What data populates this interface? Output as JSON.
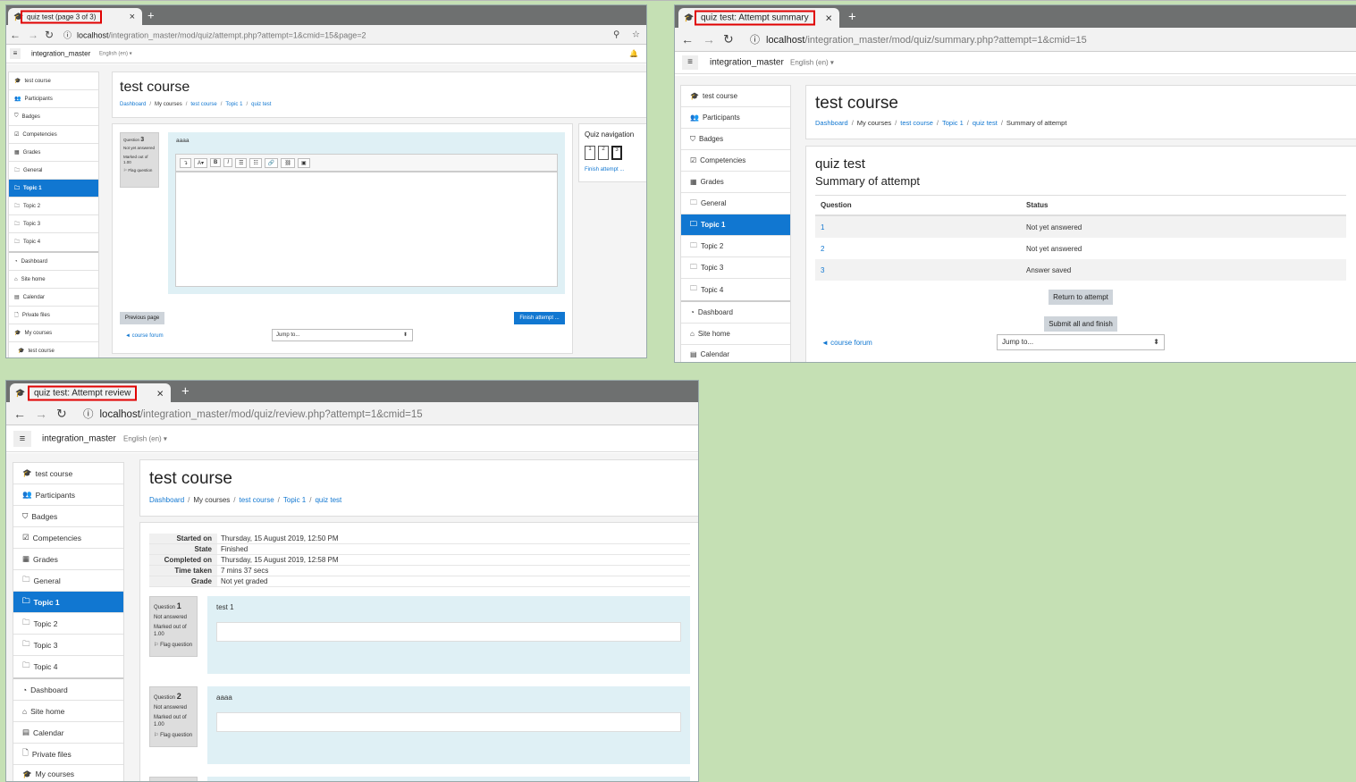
{
  "common": {
    "site_name": "integration_master",
    "language": "English (en)",
    "course_title": "test course",
    "host": "localhost",
    "breadcrumb": [
      "Dashboard",
      "My courses",
      "test course",
      "Topic 1",
      "quiz test"
    ],
    "sidebar": [
      "test course",
      "Participants",
      "Badges",
      "Competencies",
      "Grades",
      "General",
      "Topic 1",
      "Topic 2",
      "Topic 3",
      "Topic 4",
      "Dashboard",
      "Site home",
      "Calendar",
      "Private files",
      "My courses"
    ],
    "sidebar_last_child": "test course",
    "prev_activity": "◄ course forum",
    "jump_to": "Jump to...",
    "flag_question": "Flag question",
    "new_tab": "+",
    "close": "×"
  },
  "window1": {
    "tab_title": "quiz test (page 3 of 3)",
    "url_path": "/integration_master/mod/quiz/attempt.php?attempt=1&cmid=15&page=2",
    "question_label": "Question",
    "question_number": "3",
    "question_status": "Not yet answered",
    "question_marks": "Marked out of 1.00",
    "question_text": "aaaa",
    "editor_buttons": [
      "↴",
      "A▾",
      "B",
      "I",
      "☰",
      "☷",
      "🔗",
      "⛓",
      "▣"
    ],
    "quiz_nav_title": "Quiz navigation",
    "nav_boxes": [
      "1",
      "2",
      "3"
    ],
    "finish_attempt_link": "Finish attempt ...",
    "previous_page": "Previous page",
    "finish_attempt_button": "Finish attempt ..."
  },
  "window2": {
    "tab_title": "quiz test: Attempt summary",
    "url_path": "/integration_master/mod/quiz/summary.php?attempt=1&cmid=15",
    "breadcrumb_last": "Summary of attempt",
    "quiz_name": "quiz test",
    "summary_heading": "Summary of attempt",
    "columns": [
      "Question",
      "Status"
    ],
    "rows": [
      {
        "q": "1",
        "status": "Not yet answered"
      },
      {
        "q": "2",
        "status": "Not yet answered"
      },
      {
        "q": "3",
        "status": "Answer saved"
      }
    ],
    "return_button": "Return to attempt",
    "submit_button": "Submit all and finish"
  },
  "window3": {
    "tab_title": "quiz test: Attempt review",
    "url_path": "/integration_master/mod/quiz/review.php?attempt=1&cmid=15",
    "review": [
      {
        "k": "Started on",
        "v": "Thursday, 15 August 2019, 12:50 PM"
      },
      {
        "k": "State",
        "v": "Finished"
      },
      {
        "k": "Completed on",
        "v": "Thursday, 15 August 2019, 12:58 PM"
      },
      {
        "k": "Time taken",
        "v": "7 mins 37 secs"
      },
      {
        "k": "Grade",
        "v": "Not yet graded"
      }
    ],
    "questions": [
      {
        "label": "Question",
        "num": "1",
        "status": "Not answered",
        "marks": "Marked out of 1.00",
        "text": "test 1"
      },
      {
        "label": "Question",
        "num": "2",
        "status": "Not answered",
        "marks": "Marked out of 1.00",
        "text": "aaaa"
      }
    ]
  }
}
